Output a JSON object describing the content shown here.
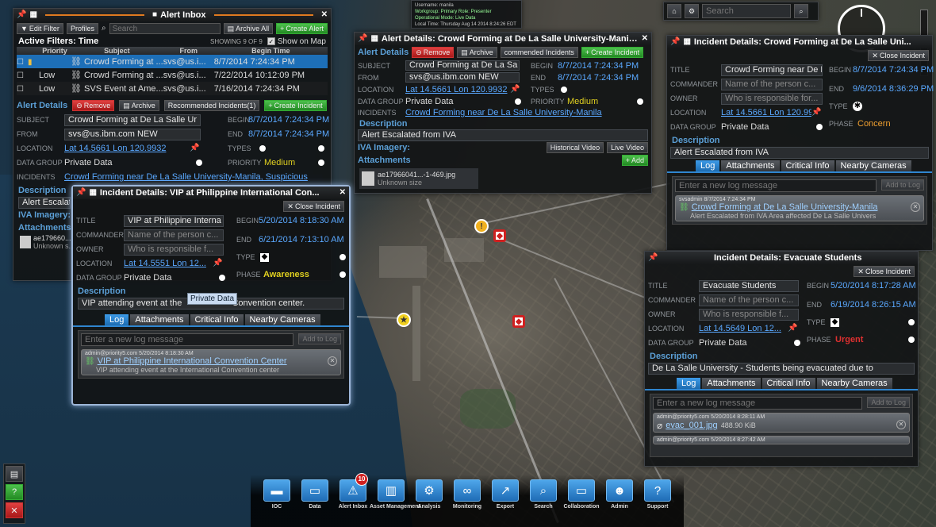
{
  "alert_inbox": {
    "title": "Alert Inbox",
    "edit_filter": "Edit Filter",
    "profiles": "Profiles",
    "search_placeholder": "Search",
    "archive_all": "Archive All",
    "create_alert": "Create Alert",
    "active_filters": "Active Filters: Time",
    "showing": "SHOWING 9 OF 9",
    "show_on_map": "Show on Map",
    "columns": [
      "Priority",
      "Subject",
      "From",
      "Begin Time"
    ],
    "rows": [
      [
        "",
        "Crowd Forming at ...",
        "svs@us.i...",
        "8/7/2014 7:24:34 PM"
      ],
      [
        "Low",
        "Crowd Forming at ...",
        "svs@us.i...",
        "7/22/2014 10:12:09 PM"
      ],
      [
        "Low",
        "SVS Event at Ame...",
        "svs@us.i...",
        "7/16/2014 7:24:34 PM"
      ]
    ],
    "details_label": "Alert Details",
    "remove": "Remove",
    "archive": "Archive",
    "recommended": "Recommended Incidents(1)",
    "create_incident": "Create Incident",
    "subject_label": "SUBJECT",
    "subject": "Crowd Forming at De La Salle Ur",
    "from_label": "FROM",
    "from": "svs@us.ibm.com NEW",
    "location_label": "LOCATION",
    "location": "Lat 14.5661 Lon 120.9932",
    "datagroup_label": "DATA GROUP",
    "datagroup": "Private Data",
    "incidents_label": "INCIDENTS",
    "incidents": "Crowd Forming near De La Salle University-Manila, Suspicious",
    "begin_label": "BEGIN",
    "begin": "8/7/2014 7:24:34 PM",
    "end_label": "END",
    "end": "8/7/2014 7:24:34 PM",
    "types_label": "TYPES",
    "priority_label": "PRIORITY",
    "priority": "Medium",
    "description_label": "Description",
    "description": "Alert Escalate",
    "iva_label": "IVA Imagery:",
    "attachments_label": "Attachments",
    "attach_name": "ae179660...",
    "attach_size": "Unknown s..."
  },
  "alert_details": {
    "title": "Alert Details: Crowd Forming at De La Salle University-Mania...",
    "label": "Alert Details",
    "remove": "Remove",
    "archive": "Archive",
    "recommended": "commended Incidents",
    "create_incident": "Create Incident",
    "subject": "Crowd Forming at De La Sa",
    "from": "svs@us.ibm.com NEW",
    "location": "Lat 14.5661 Lon 120.9932",
    "datagroup": "Private Data",
    "incidents": "Crowd Forming near De La Salle University-Manila",
    "subject_label": "SUBJECT",
    "from_label": "FROM",
    "location_label": "LOCATION",
    "datagroup_label": "DATA GROUP",
    "incidents_label": "INCIDENTS",
    "begin_label": "BEGIN",
    "begin": "8/7/2014 7:24:34 PM",
    "end_label": "END",
    "end": "8/7/2014 7:24:34 PM",
    "types_label": "TYPES",
    "priority_label": "PRIORITY",
    "priority": "Medium",
    "description_label": "Description",
    "description": "Alert Escalated from IVA",
    "iva_label": "IVA Imagery:",
    "historical": "Historical Video",
    "live": "Live Video",
    "attachments_label": "Attachments",
    "add": "Add",
    "attach_name": "ae17966041...-1-469.jpg",
    "attach_size": "Unknown size"
  },
  "status_box": {
    "line1": "Username: manila",
    "line2": "Workgroup: Primary Role: Presenter",
    "line3": "Operational Mode: Live Data",
    "line4": "Local Time: Thursday Aug 14 2014 8:24:26 EDT"
  },
  "search": {
    "placeholder": "Search"
  },
  "incident_vip": {
    "title": "Incident Details: VIP at Philippine International Con...",
    "close": "Close Incident",
    "title_label": "TITLE",
    "title_val": "VIP at Philippine Interna",
    "commander_label": "COMMANDER",
    "commander_ph": "Name of the person c...",
    "owner_label": "OWNER",
    "owner_ph": "Who is responsible f...",
    "location_label": "LOCATION",
    "location": "Lat 14.5551 Lon 12...",
    "datagroup_label": "DATA GROUP",
    "datagroup": "Private Data",
    "begin_label": "BEGIN",
    "begin": "5/20/2014 8:18:30 AM",
    "end_label": "END",
    "end": "6/21/2014 7:13:10 AM",
    "type_label": "TYPE",
    "phase_label": "PHASE",
    "phase": "Awareness",
    "description_label": "Description",
    "description": "VIP attending event at the",
    "description2": "Convention center.",
    "tooltip": "Private Data",
    "tabs": [
      "Log",
      "Attachments",
      "Critical Info",
      "Nearby Cameras"
    ],
    "log_placeholder": "Enter a new log message",
    "add_log": "Add to Log",
    "entry_meta": "admin@priority5.com    5/20/2014 8:18:30 AM",
    "entry_title": "VIP at Philippine International Convention Center",
    "entry_desc": "VIP attending event at the International Convention center"
  },
  "incident_crowd": {
    "title": "Incident Details: Crowd Forming at De La Salle Uni...",
    "close": "Close Incident",
    "title_label": "TITLE",
    "title_val": "Crowd Forming near De La",
    "commander_label": "COMMANDER",
    "commander_ph": "Name of the person c...",
    "owner_label": "OWNER",
    "owner_ph": "Who is responsible for...",
    "location_label": "LOCATION",
    "location": "Lat 14.5661 Lon 120.99...",
    "datagroup_label": "DATA GROUP",
    "datagroup": "Private Data",
    "begin_label": "BEGIN",
    "begin": "8/7/2014 7:24:34 PM",
    "end_label": "END",
    "end": "9/6/2014 8:36:29 PM",
    "type_label": "TYPE",
    "phase_label": "PHASE",
    "phase": "Concern",
    "description_label": "Description",
    "description": "Alert Escalated from IVA",
    "tabs": [
      "Log",
      "Attachments",
      "Critical Info",
      "Nearby Cameras"
    ],
    "log_placeholder": "Enter a new log message",
    "add_log": "Add to Log",
    "entry_meta": "svsadmin    8/7/2014 7:24:34 PM",
    "entry_title": "Crowd Forming at De La Salle University-Manila",
    "entry_desc": "Alert Escalated from IVA Area affected De La Salle Univers"
  },
  "incident_evac": {
    "title": "Incident Details: Evacuate Students",
    "close": "Close Incident",
    "title_label": "TITLE",
    "title_val": "Evacuate Students",
    "commander_label": "COMMANDER",
    "commander_ph": "Name of the person c...",
    "owner_label": "OWNER",
    "owner_ph": "Who is responsible f...",
    "location_label": "LOCATION",
    "location": "Lat 14.5649 Lon 12...",
    "datagroup_label": "DATA GROUP",
    "datagroup": "Private Data",
    "begin_label": "BEGIN",
    "begin": "5/20/2014 8:17:28 AM",
    "end_label": "END",
    "end": "6/19/2014 8:26:15 AM",
    "type_label": "TYPE",
    "phase_label": "PHASE",
    "phase": "Urgent",
    "description_label": "Description",
    "description": "De La Salle University - Students being evacuated due to",
    "tabs": [
      "Log",
      "Attachments",
      "Critical Info",
      "Nearby Cameras"
    ],
    "log_placeholder": "Enter a new log message",
    "add_log": "Add to Log",
    "entry_meta": "admin@priority5.com    5/20/2014 8:28:11 AM",
    "entry_title": "evac_001.jpg",
    "entry_size": "488.90 KiB",
    "entry2_meta": "admin@priority5.com    5/20/2014 8:27:42 AM"
  },
  "toolbar": {
    "items": [
      "IOC",
      "Data",
      "Alert Inbox",
      "Asset Management",
      "Analysis",
      "Monitoring",
      "Export",
      "Search",
      "Collaboration",
      "Admin",
      "Support"
    ],
    "badge": "10"
  },
  "colors": {
    "accent": "#2f86d0",
    "priority_medium": "#e0d020",
    "phase_concern": "#f0a030",
    "phase_urgent": "#e03030",
    "phase_awareness": "#e0d020"
  }
}
